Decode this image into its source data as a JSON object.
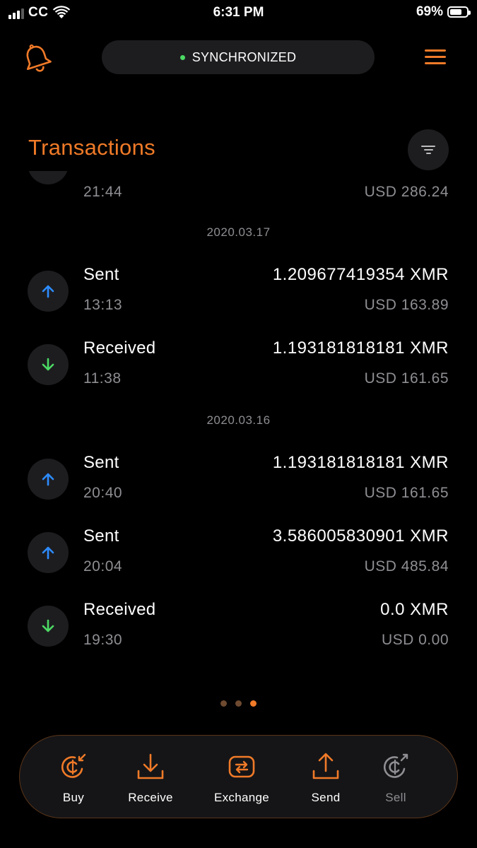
{
  "status_bar": {
    "carrier": "CC",
    "time": "6:31 PM",
    "battery": "69%"
  },
  "header": {
    "sync_status": "SYNCHRONIZED",
    "sync_color": "#4cd964",
    "accent_color": "#f07a28"
  },
  "page": {
    "title": "Transactions"
  },
  "transactions": {
    "partial": {
      "time": "21:44",
      "fiat": "USD 286.24",
      "direction": "in"
    },
    "groups": [
      {
        "date": "2020.03.17",
        "items": [
          {
            "type": "Sent",
            "time": "13:13",
            "amount": "1.209677419354 XMR",
            "fiat": "USD 163.89",
            "direction": "out"
          },
          {
            "type": "Received",
            "time": "11:38",
            "amount": "1.193181818181 XMR",
            "fiat": "USD 161.65",
            "direction": "in"
          }
        ]
      },
      {
        "date": "2020.03.16",
        "items": [
          {
            "type": "Sent",
            "time": "20:40",
            "amount": "1.193181818181 XMR",
            "fiat": "USD 161.65",
            "direction": "out"
          },
          {
            "type": "Sent",
            "time": "20:04",
            "amount": "3.586005830901 XMR",
            "fiat": "USD 485.84",
            "direction": "out"
          },
          {
            "type": "Received",
            "time": "19:30",
            "amount": "0.0 XMR",
            "fiat": "USD 0.00",
            "direction": "in"
          }
        ]
      }
    ]
  },
  "pager": {
    "count": 3,
    "active": 3
  },
  "actions": {
    "buy": "Buy",
    "receive": "Receive",
    "exchange": "Exchange",
    "send": "Send",
    "sell": "Sell"
  }
}
